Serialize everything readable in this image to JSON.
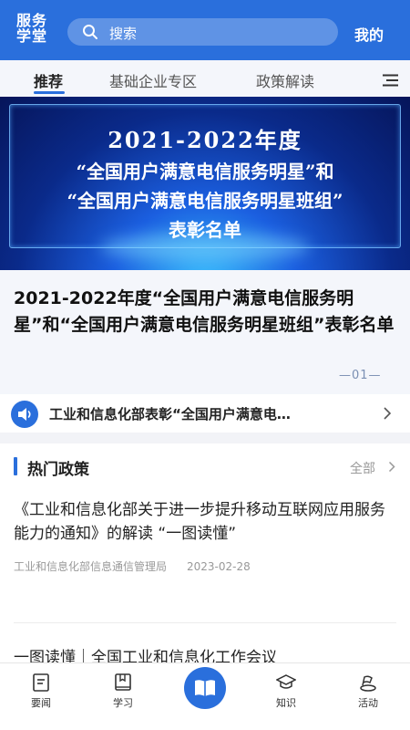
{
  "header": {
    "logo_line1": "服务",
    "logo_line2": "学堂",
    "search_placeholder": "搜索",
    "mine_label": "我的"
  },
  "tabs": [
    {
      "label": "推荐",
      "active": true
    },
    {
      "label": "基础企业专区",
      "active": false
    },
    {
      "label": "政策解读",
      "active": false
    }
  ],
  "banner": {
    "line1": "2021-2022年度",
    "line2": "“全国用户满意电信服务明星”和",
    "line3": "“全国用户满意电信服务明星班组”",
    "line4": "表彰名单"
  },
  "featured": {
    "title": "2021-2022年度“全国用户满意电信服务明星”和“全国用户满意电信服务明星班组”表彰名单",
    "page_indicator": "—01—"
  },
  "notice": {
    "text": "工业和信息化部表彰“全国用户满意电…"
  },
  "hot_policy": {
    "title": "热门政策",
    "all_label": "全部",
    "items": [
      {
        "title": "《工业和信息化部关于进一步提升移动互联网应用服务能力的通知》的解读 “一图读懂”",
        "source": "工业和信息化部信息通信管理局",
        "date": "2023-02-28"
      },
      {
        "title": "一图读懂｜全国工业和信息化工作会议"
      }
    ]
  },
  "bottom_nav": [
    {
      "label": "要闻",
      "icon": "news-icon"
    },
    {
      "label": "学习",
      "icon": "book-icon"
    },
    {
      "label": "",
      "icon": "open-book-icon"
    },
    {
      "label": "知识",
      "icon": "graduation-cap-icon"
    },
    {
      "label": "活动",
      "icon": "activity-icon"
    }
  ],
  "colors": {
    "primary": "#2a6fdc",
    "page_bg": "#f2f3f7",
    "muted_text": "#999999"
  }
}
